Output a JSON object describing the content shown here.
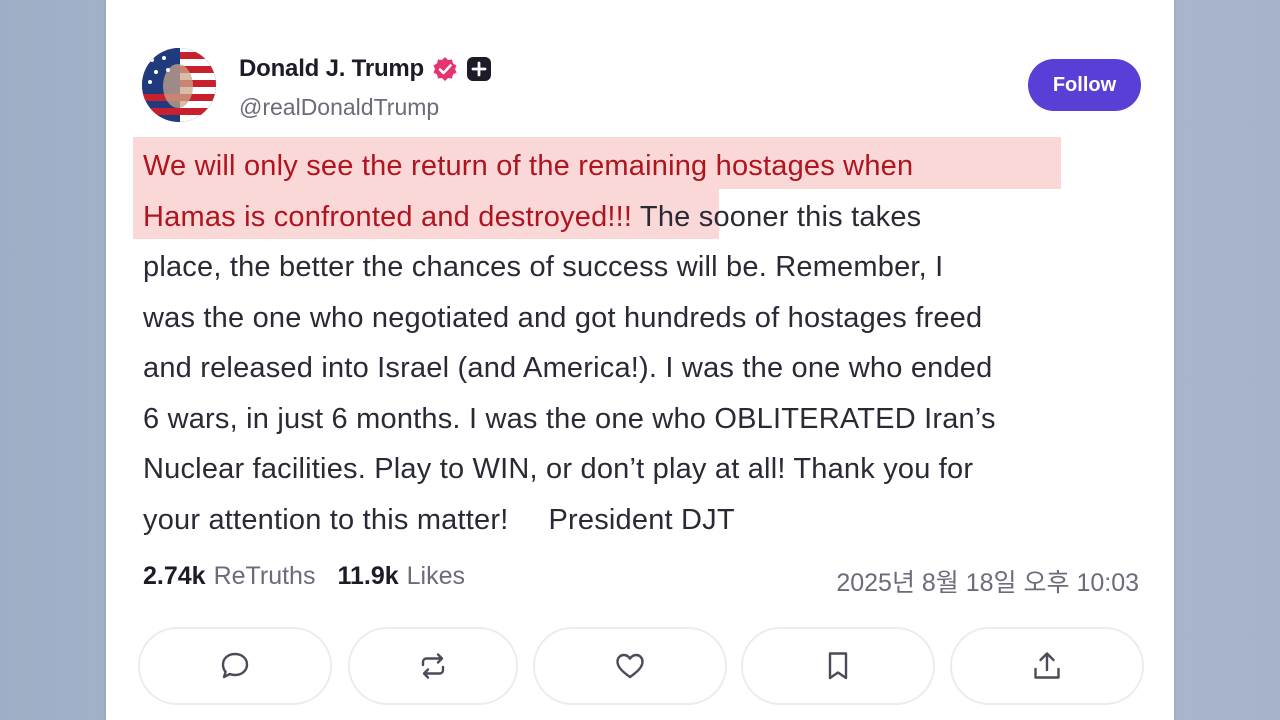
{
  "post": {
    "author_name": "Donald J. Trump",
    "handle": "@realDonaldTrump",
    "follow_label": "Follow",
    "highlight_line1": "We will only see the return of the remaining hostages when",
    "highlight_line2": "Hamas is confronted and destroyed!!!",
    "body_line2_rest": " The sooner this takes",
    "body_line3": "place, the better the chances of success will be. Remember, I",
    "body_line4": "was the one who negotiated and got hundreds of hostages freed",
    "body_line5": "and released into Israel (and America!). I was the one who ended",
    "body_line6": "6 wars, in just 6 months. I was the one who OBLITERATED Iran’s",
    "body_line7": "Nuclear facilities. Play to WIN, or don’t play at all! Thank you for",
    "body_line8": "your attention to this matter!",
    "signature": "President DJT",
    "retruths_count": "2.74k",
    "retruths_label": "ReTruths",
    "likes_count": "11.9k",
    "likes_label": "Likes",
    "timestamp": "2025년 8월 18일 오후 10:03"
  },
  "actions": [
    {
      "name": "reply",
      "icon": "comment-icon"
    },
    {
      "name": "retruth",
      "icon": "repost-icon"
    },
    {
      "name": "like",
      "icon": "heart-icon"
    },
    {
      "name": "bookmark",
      "icon": "bookmark-icon"
    },
    {
      "name": "share",
      "icon": "share-icon"
    }
  ],
  "colors": {
    "accent": "#5a3fd6",
    "highlight_bg": "#fbd8d8",
    "highlight_text": "#b0141e",
    "verified": "#e5356f"
  }
}
